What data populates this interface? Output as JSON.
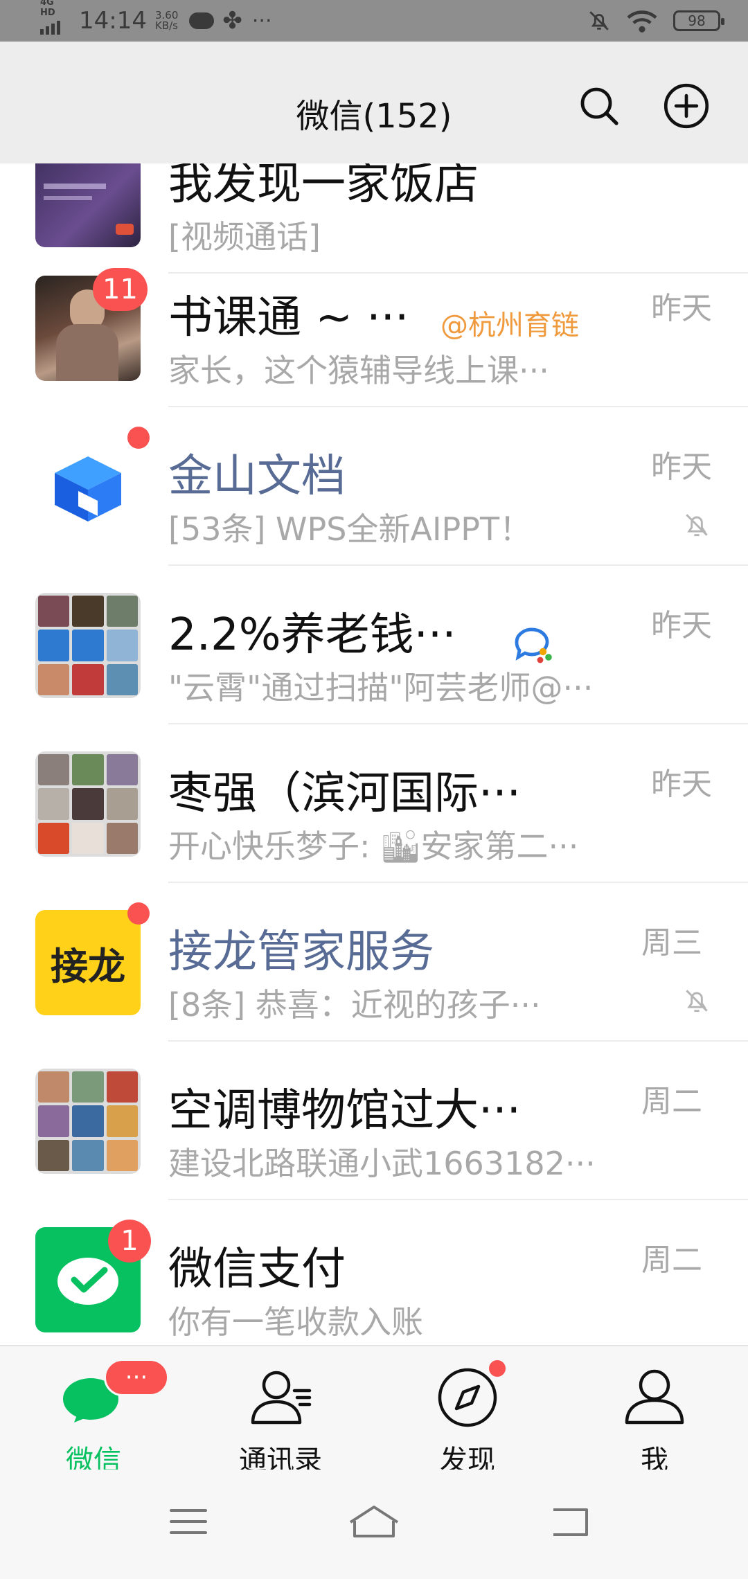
{
  "status_bar": {
    "network": "4G HD",
    "time": "14:14",
    "speed_value": "3.60",
    "speed_unit": "KB/s",
    "more": "···",
    "battery": "98"
  },
  "header": {
    "title": "微信(152)"
  },
  "chats": [
    {
      "name": "我发现一家饭店",
      "preview": "[视频通话]",
      "time": "",
      "partial": true
    },
    {
      "name": "书课通 ~ ···",
      "mention": "@杭州育链",
      "preview": "家长，这个猿辅导线上课···",
      "time": "昨天",
      "badge": "11"
    },
    {
      "name": "金山文档",
      "preview": "[53条] WPS全新AIPPT！",
      "time": "昨天",
      "dot": true,
      "muted": true,
      "official": true
    },
    {
      "name": "2.2%养老钱···",
      "preview": "\"云霄\"通过扫描\"阿芸老师@···",
      "time": "昨天"
    },
    {
      "name": "枣强（滨河国际···",
      "preview": "开心快乐梦子: 🏙安家第二···",
      "time": "昨天"
    },
    {
      "name": "接龙管家服务",
      "preview": "[8条] 恭喜：近视的孩子···",
      "time": "周三",
      "dot": true,
      "muted": true,
      "official": true,
      "avatar_text": "接龙"
    },
    {
      "name": "空调博物馆过大···",
      "preview": "建设北路联通小武1663182···",
      "time": "周二"
    },
    {
      "name": "微信支付",
      "preview": "你有一笔收款入账",
      "time": "周二",
      "badge": "1"
    }
  ],
  "tabs": [
    {
      "label": "微信",
      "active": true,
      "badge": "···"
    },
    {
      "label": "通讯录"
    },
    {
      "label": "发现",
      "dot": true
    },
    {
      "label": "我"
    }
  ],
  "colors": {
    "brand_green": "#07c160",
    "badge_red": "#fa5151",
    "official_blue": "#576b95",
    "mention_orange": "#f09a3e"
  }
}
